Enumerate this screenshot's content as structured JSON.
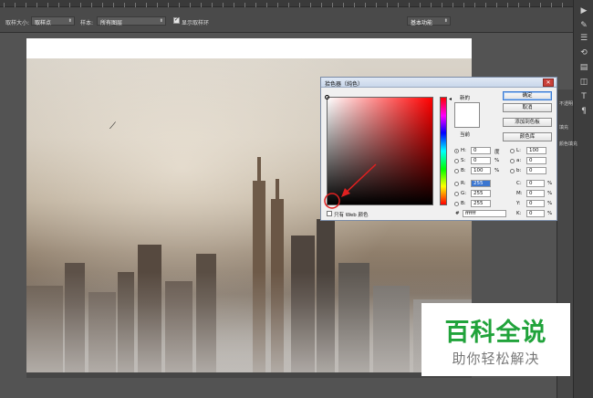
{
  "options_bar": {
    "sample_size_label": "取样大小:",
    "sample_size_value": "取样点",
    "sample_label": "样本:",
    "sample_value": "所有图层",
    "show_ring_label": "显示取样环",
    "workspace_value": "基本功能"
  },
  "right_panel": {
    "layer_label_1": "不透明",
    "layer_label_2": "填充",
    "layer_name": "颜色填充"
  },
  "color_picker": {
    "title": "拾色器（纯色）",
    "new_label": "新的",
    "current_label": "当前",
    "ok_button": "确定",
    "cancel_button": "取消",
    "add_swatch_button": "添加到色板",
    "color_libraries_button": "颜色库",
    "only_web_colors": "只有 Web 颜色",
    "fields": {
      "H": {
        "label": "H:",
        "value": "0",
        "unit": "度"
      },
      "S": {
        "label": "S:",
        "value": "0",
        "unit": "%"
      },
      "B": {
        "label": "B:",
        "value": "100",
        "unit": "%"
      },
      "R": {
        "label": "R:",
        "value": "255"
      },
      "G": {
        "label": "G:",
        "value": "255"
      },
      "Bl": {
        "label": "B:",
        "value": "255"
      },
      "L": {
        "label": "L:",
        "value": "100"
      },
      "a": {
        "label": "a:",
        "value": "0"
      },
      "b": {
        "label": "b:",
        "value": "0"
      },
      "C": {
        "label": "C:",
        "value": "0",
        "unit": "%"
      },
      "M": {
        "label": "M:",
        "value": "0",
        "unit": "%"
      },
      "Y": {
        "label": "Y:",
        "value": "0",
        "unit": "%"
      },
      "K": {
        "label": "K:",
        "value": "0",
        "unit": "%"
      },
      "hex": {
        "label": "#",
        "value": "ffffff"
      }
    },
    "selected_color": "#ffffff",
    "annotation_color": "#e02020"
  },
  "watermark": {
    "title": "百科全说",
    "subtitle": "助你轻松解决",
    "title_color": "#21a33b"
  }
}
